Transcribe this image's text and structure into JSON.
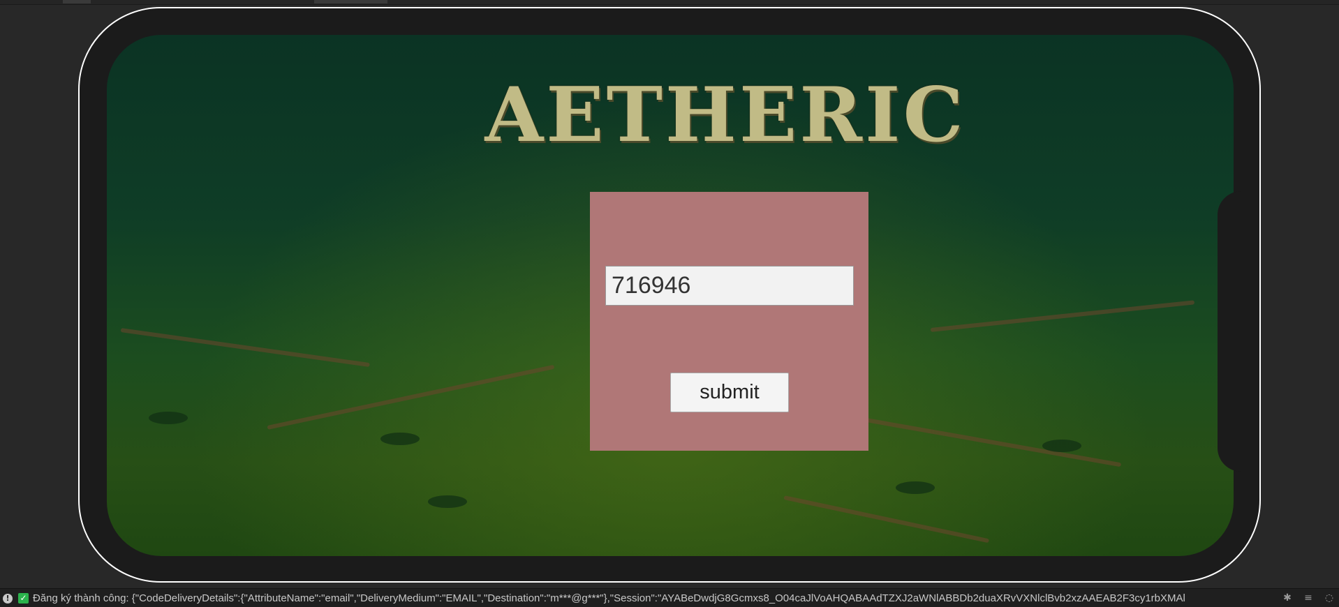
{
  "game": {
    "title": "AETHERIC",
    "verification_code_value": "716946",
    "submit_label": "submit"
  },
  "status_bar": {
    "message": "Đăng ký thành công: {\"CodeDeliveryDetails\":{\"AttributeName\":\"email\",\"DeliveryMedium\":\"EMAIL\",\"Destination\":\"m***@g***\"},\"Session\":\"AYABeDwdjG8Gcmxs8_O04caJlVoAHQABAAdTZXJ2aWNlABBDb2duaXRvVXNlclBvb2xzAAEAB2F3cy1rbXMAl",
    "icons": [
      "info-icon",
      "success-check-icon",
      "bug-icon",
      "layers-icon",
      "progress-icon"
    ]
  },
  "colors": {
    "panel": "#b07777",
    "title": "#c1bb86",
    "success": "#2bb24c"
  }
}
